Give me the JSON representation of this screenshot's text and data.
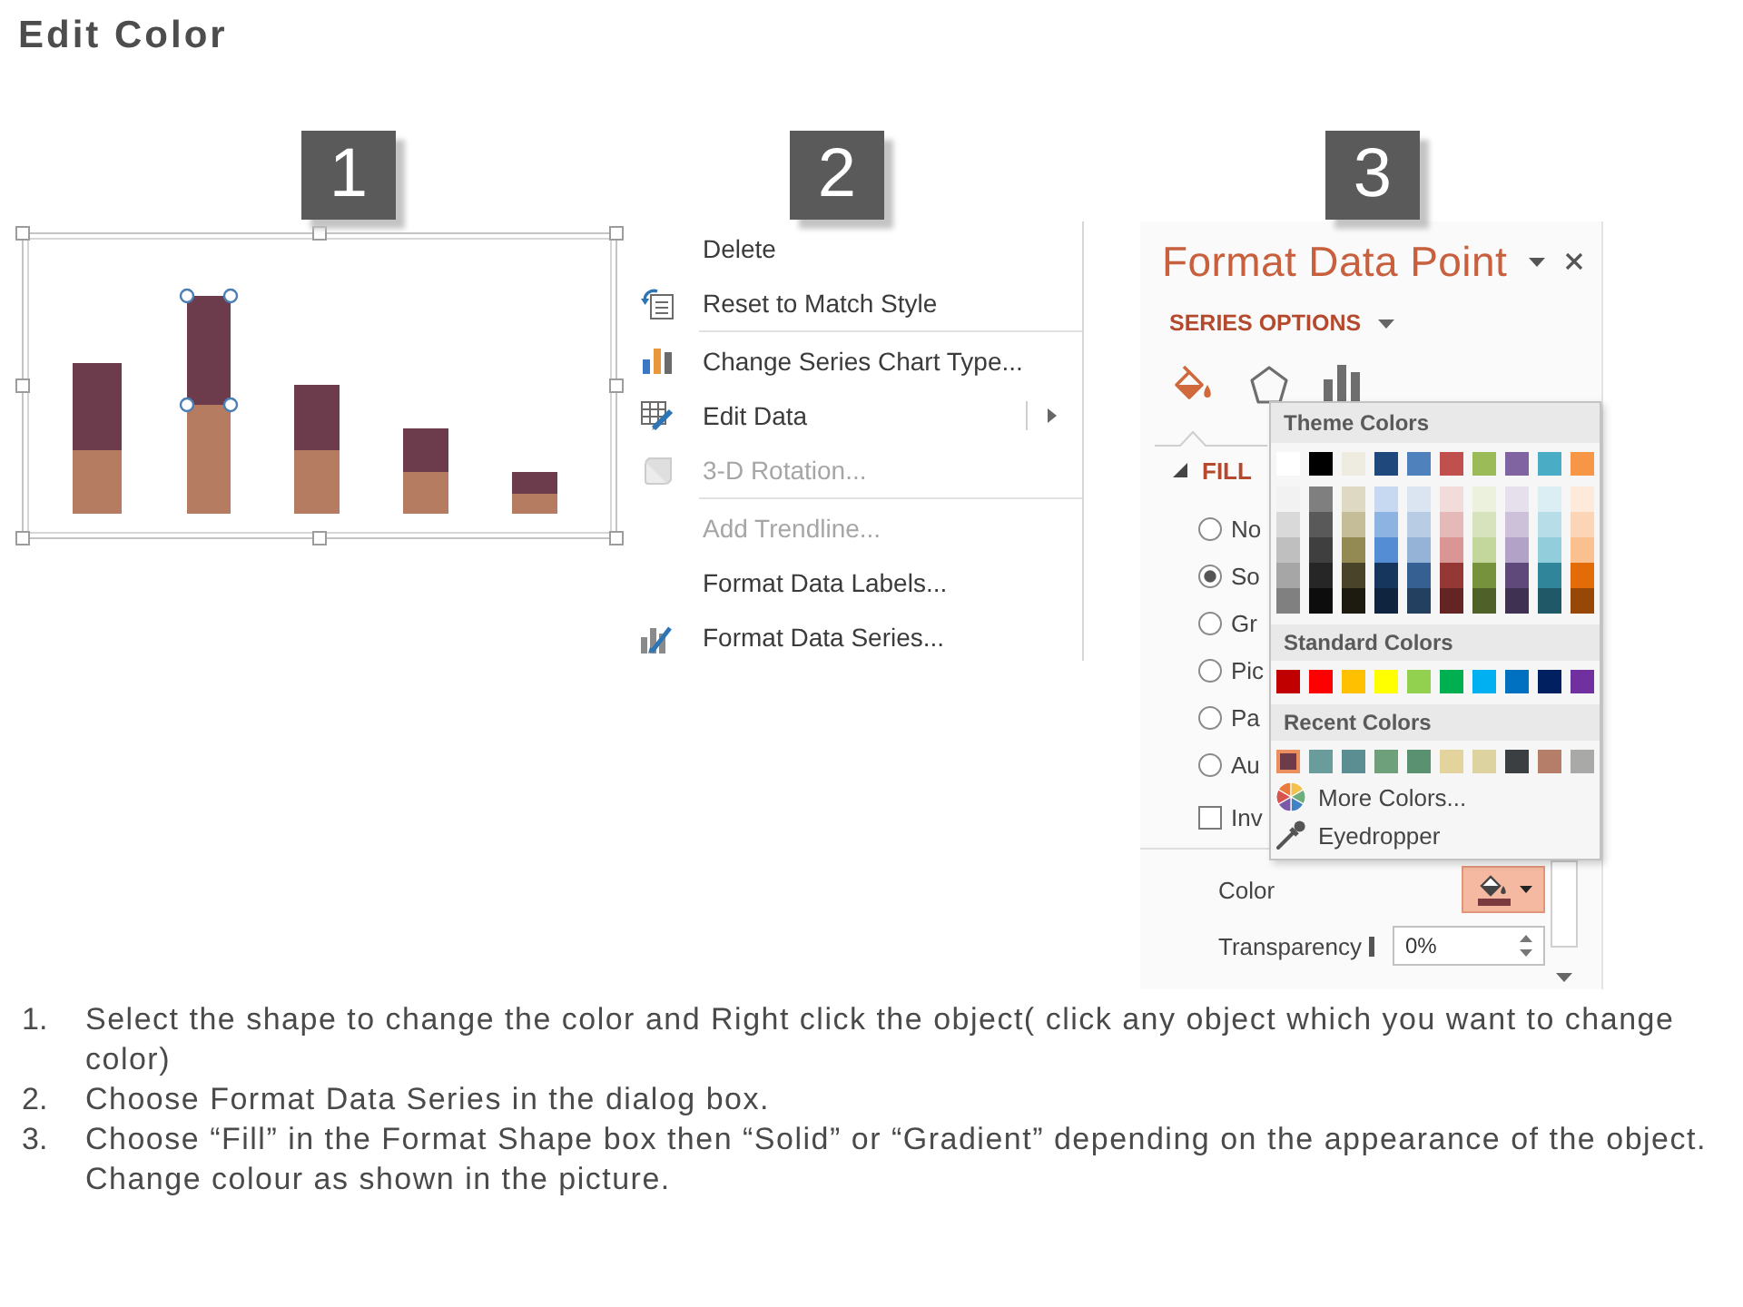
{
  "title": "Edit Color",
  "chart_panel": {
    "step": "1",
    "bars": [
      {
        "selected": false
      },
      {
        "selected": true
      },
      {
        "selected": false
      },
      {
        "selected": false
      },
      {
        "selected": false
      }
    ]
  },
  "context_menu": {
    "step": "2",
    "sections": [
      {
        "items": [
          {
            "label": "Delete",
            "disabled": false,
            "has_submenu": false
          },
          {
            "label": "Reset to Match Style",
            "disabled": false,
            "has_submenu": false
          }
        ]
      },
      {
        "items": [
          {
            "label": "Change Series Chart Type...",
            "disabled": false,
            "has_submenu": false
          },
          {
            "label": "Edit Data",
            "disabled": false,
            "has_submenu": true
          },
          {
            "label": "3-D Rotation...",
            "disabled": true,
            "has_submenu": false
          }
        ]
      },
      {
        "items": [
          {
            "label": "Add Trendline...",
            "disabled": true,
            "has_submenu": false
          },
          {
            "label": "Format Data Labels...",
            "disabled": false,
            "has_submenu": false
          },
          {
            "label": "Format Data Series...",
            "disabled": false,
            "has_submenu": false
          }
        ]
      }
    ]
  },
  "format_pane": {
    "step": "3",
    "title": "Format Data Point",
    "options_menu": "SERIES OPTIONS",
    "tabs": [
      {
        "selected": true
      },
      {
        "selected": false
      },
      {
        "selected": false
      }
    ],
    "fill": {
      "label": "FILL",
      "expanded": true,
      "options": [
        {
          "label": "No",
          "selected": false
        },
        {
          "label": "So",
          "selected": true
        },
        {
          "label": "Gr",
          "selected": false
        },
        {
          "label": "Pic",
          "selected": false
        },
        {
          "label": "Pa",
          "selected": false
        },
        {
          "label": "Au",
          "selected": false
        }
      ],
      "invert": {
        "label": "Inv",
        "checked": false
      }
    },
    "color": {
      "label": "Color"
    },
    "transparency": {
      "label": "Transparency",
      "level": 0,
      "value": "0%"
    },
    "palette": {
      "theme_label": "Theme Colors",
      "theme": [
        {
          "color": "#ffffff",
          "shades": [
            {
              "color": "#f2f2f2"
            },
            {
              "color": "#d9d9d9"
            },
            {
              "color": "#bfbfbf"
            },
            {
              "color": "#a6a6a6"
            },
            {
              "color": "#808080"
            }
          ]
        },
        {
          "color": "#000000",
          "shades": [
            {
              "color": "#7f7f7f"
            },
            {
              "color": "#595959"
            },
            {
              "color": "#3f3f3f"
            },
            {
              "color": "#262626"
            },
            {
              "color": "#0d0d0d"
            }
          ]
        },
        {
          "color": "#eeece1",
          "shades": [
            {
              "color": "#ddd9c3"
            },
            {
              "color": "#c4bd97"
            },
            {
              "color": "#938953"
            },
            {
              "color": "#494429"
            },
            {
              "color": "#1d1b10"
            }
          ]
        },
        {
          "color": "#1f497d",
          "shades": [
            {
              "color": "#c6d9f0"
            },
            {
              "color": "#8db3e2"
            },
            {
              "color": "#548dd4"
            },
            {
              "color": "#17365d"
            },
            {
              "color": "#0f243e"
            }
          ]
        },
        {
          "color": "#4f81bd",
          "shades": [
            {
              "color": "#dbe5f1"
            },
            {
              "color": "#b8cce4"
            },
            {
              "color": "#95b3d7"
            },
            {
              "color": "#366092"
            },
            {
              "color": "#244061"
            }
          ]
        },
        {
          "color": "#c0504d",
          "shades": [
            {
              "color": "#f2dcdb"
            },
            {
              "color": "#e5b9b7"
            },
            {
              "color": "#d99694"
            },
            {
              "color": "#953734"
            },
            {
              "color": "#632423"
            }
          ]
        },
        {
          "color": "#9bbb59",
          "shades": [
            {
              "color": "#ebf1dd"
            },
            {
              "color": "#d7e3bc"
            },
            {
              "color": "#c3d69b"
            },
            {
              "color": "#76923c"
            },
            {
              "color": "#4f6128"
            }
          ]
        },
        {
          "color": "#8064a2",
          "shades": [
            {
              "color": "#e5e0ec"
            },
            {
              "color": "#ccc1d9"
            },
            {
              "color": "#b2a2c7"
            },
            {
              "color": "#5f497a"
            },
            {
              "color": "#3f3151"
            }
          ]
        },
        {
          "color": "#4bacc6",
          "shades": [
            {
              "color": "#dbeef3"
            },
            {
              "color": "#b7dde8"
            },
            {
              "color": "#92cddc"
            },
            {
              "color": "#31859b"
            },
            {
              "color": "#205867"
            }
          ]
        },
        {
          "color": "#f79646",
          "shades": [
            {
              "color": "#fdeada"
            },
            {
              "color": "#fbd5b5"
            },
            {
              "color": "#fac08f"
            },
            {
              "color": "#e36c09"
            },
            {
              "color": "#974806"
            }
          ]
        }
      ],
      "standard_label": "Standard Colors",
      "standard": [
        {
          "color": "#c00000"
        },
        {
          "color": "#ff0000"
        },
        {
          "color": "#ffc000"
        },
        {
          "color": "#ffff00"
        },
        {
          "color": "#92d050"
        },
        {
          "color": "#00b050"
        },
        {
          "color": "#00b0f0"
        },
        {
          "color": "#0070c0"
        },
        {
          "color": "#002060"
        },
        {
          "color": "#7030a0"
        }
      ],
      "recent_label": "Recent Colors",
      "recent": [
        {
          "color": "#6e3b4a",
          "selected": true
        },
        {
          "color": "#6a9c9c",
          "selected": false
        },
        {
          "color": "#5b8e92",
          "selected": false
        },
        {
          "color": "#6ea07c",
          "selected": false
        },
        {
          "color": "#5a9170",
          "selected": false
        },
        {
          "color": "#e2d49c",
          "selected": false
        },
        {
          "color": "#dcd3a0",
          "selected": false
        },
        {
          "color": "#3b3f41",
          "selected": false
        },
        {
          "color": "#b47e68",
          "selected": false
        },
        {
          "color": "#a9aaa7",
          "selected": false
        }
      ],
      "more_colors": "More Colors...",
      "eyedropper": "Eyedropper"
    }
  },
  "instructions": [
    {
      "number": "1.",
      "text": "Select the shape to change the color and Right click the object( click any object which you want to change color)"
    },
    {
      "number": "2.",
      "text": "Choose Format Data Series in the dialog box."
    },
    {
      "number": "3.",
      "text": "Choose “Fill” in the Format Shape box then “Solid” or “Gradient” depending on the appearance of the object. Change colour as shown in the picture."
    }
  ]
}
